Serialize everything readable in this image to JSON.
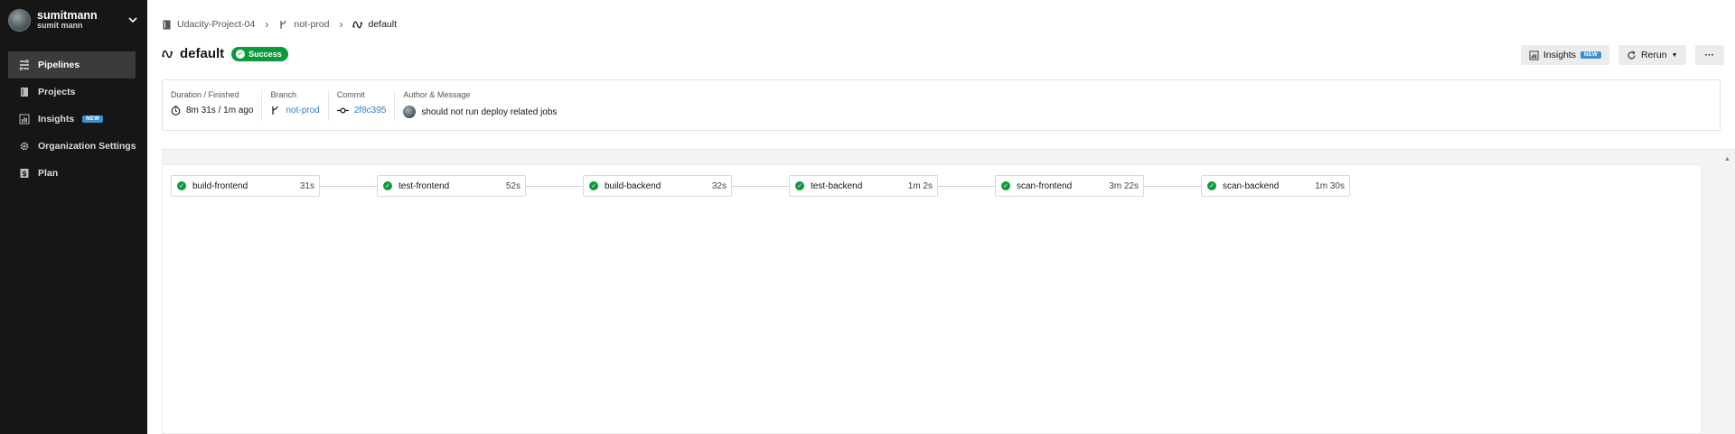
{
  "org": {
    "name": "sumitmann",
    "user": "sumit mann"
  },
  "nav": [
    {
      "label": "Pipelines",
      "icon": "pipelines-icon",
      "active": true
    },
    {
      "label": "Projects",
      "icon": "projects-icon"
    },
    {
      "label": "Insights",
      "icon": "insights-icon",
      "badge": "NEW"
    },
    {
      "label": "Organization Settings",
      "icon": "gear-icon"
    },
    {
      "label": "Plan",
      "icon": "dollar-icon"
    }
  ],
  "breadcrumb": {
    "project": "Udacity-Project-04",
    "branch": "not-prod",
    "workflow": "default"
  },
  "title": "default",
  "status": "Success",
  "actions": {
    "insights": "Insights",
    "insights_badge": "NEW",
    "rerun": "Rerun",
    "more": "···"
  },
  "meta": {
    "duration_label": "Duration / Finished",
    "duration_value": "8m 31s / 1m ago",
    "branch_label": "Branch",
    "branch_value": "not-prod",
    "commit_label": "Commit",
    "commit_value": "2f8c395",
    "author_label": "Author & Message",
    "author_message": "should not run deploy related jobs"
  },
  "jobs": [
    {
      "name": "build-frontend",
      "duration": "31s"
    },
    {
      "name": "test-frontend",
      "duration": "52s"
    },
    {
      "name": "build-backend",
      "duration": "32s"
    },
    {
      "name": "test-backend",
      "duration": "1m 2s"
    },
    {
      "name": "scan-frontend",
      "duration": "3m 22s"
    },
    {
      "name": "scan-backend",
      "duration": "1m 30s"
    }
  ],
  "colors": {
    "sidebar": "#161616",
    "success": "#0c9b3b",
    "link": "#2f7dc8",
    "badge": "#3d8fd1"
  }
}
